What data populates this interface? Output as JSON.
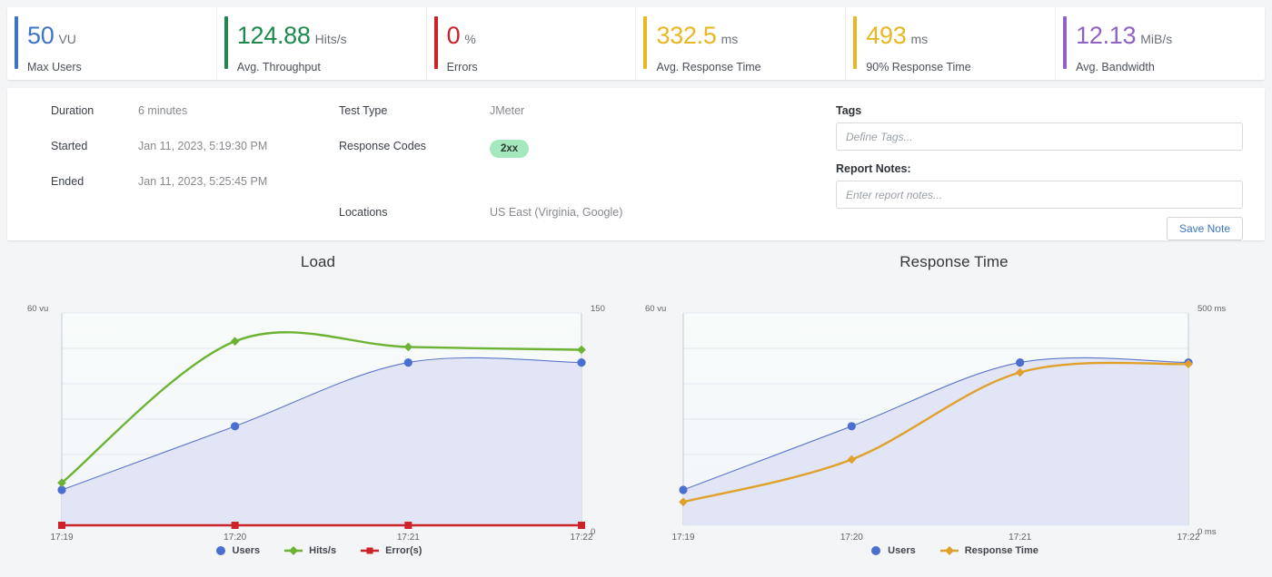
{
  "kpis": [
    {
      "value": "50",
      "unit": "VU",
      "caption": "Max Users",
      "color": "#3b76c4"
    },
    {
      "value": "124.88",
      "unit": "Hits/s",
      "caption": "Avg. Throughput",
      "color": "#1d8a4c"
    },
    {
      "value": "0",
      "unit": "%",
      "caption": "Errors",
      "color": "#cf2027"
    },
    {
      "value": "332.5",
      "unit": "ms",
      "caption": "Avg. Response Time",
      "color": "#e9b722"
    },
    {
      "value": "493",
      "unit": "ms",
      "caption": "90% Response Time",
      "color": "#e9b722"
    },
    {
      "value": "12.13",
      "unit": "MiB/s",
      "caption": "Avg. Bandwidth",
      "color": "#8f62c4"
    }
  ],
  "detail": {
    "duration_label": "Duration",
    "duration_value": "6 minutes",
    "started_label": "Started",
    "started_value": "Jan 11, 2023, 5:19:30 PM",
    "ended_label": "Ended",
    "ended_value": "Jan 11, 2023, 5:25:45 PM",
    "test_type_label": "Test Type",
    "test_type_value": "JMeter",
    "response_codes_label": "Response Codes",
    "response_codes_badge": "2xx",
    "locations_label": "Locations",
    "locations_value": "US East (Virginia, Google)",
    "tags_label": "Tags",
    "tags_value": "",
    "tags_placeholder": "Define Tags...",
    "notes_label": "Report Notes:",
    "notes_value": "",
    "notes_placeholder": "Enter report notes...",
    "save_note_label": "Save Note"
  },
  "chart_data": [
    {
      "type": "line",
      "title": "Load",
      "x": [
        "17:19",
        "17:20",
        "17:21",
        "17:22"
      ],
      "xlabel": "",
      "left_axis_label": "60 vu",
      "right_axis_top": "150",
      "right_axis_bottom": "0",
      "ylim": [
        0,
        60
      ],
      "y2lim": [
        0,
        150
      ],
      "grid": true,
      "legend_position": "bottom",
      "series": [
        {
          "name": "Users",
          "axis": "left",
          "values": [
            10,
            28,
            46,
            46
          ],
          "color": "#4b6fd0",
          "marker": "circle",
          "area": true
        },
        {
          "name": "Hits/s",
          "axis": "right",
          "values": [
            30,
            130,
            126,
            124
          ],
          "color": "#6cb333",
          "marker": "diamond",
          "area": false
        },
        {
          "name": "Error(s)",
          "axis": "right",
          "values": [
            0,
            0,
            0,
            0
          ],
          "color": "#cc2229",
          "marker": "square",
          "area": false
        }
      ]
    },
    {
      "type": "line",
      "title": "Response Time",
      "x": [
        "17:19",
        "17:20",
        "17:21",
        "17:22"
      ],
      "xlabel": "",
      "left_axis_label": "60 vu",
      "right_axis_top": "500 ms",
      "right_axis_bottom": "0 ms",
      "ylim": [
        0,
        60
      ],
      "y2lim": [
        0,
        500
      ],
      "grid": true,
      "legend_position": "bottom",
      "series": [
        {
          "name": "Users",
          "axis": "left",
          "values": [
            10,
            28,
            46,
            46
          ],
          "color": "#4b6fd0",
          "marker": "circle",
          "area": true
        },
        {
          "name": "Response Time",
          "axis": "right",
          "values": [
            55,
            155,
            360,
            380
          ],
          "color": "#e0a12c",
          "marker": "diamond",
          "area": false
        }
      ]
    }
  ]
}
